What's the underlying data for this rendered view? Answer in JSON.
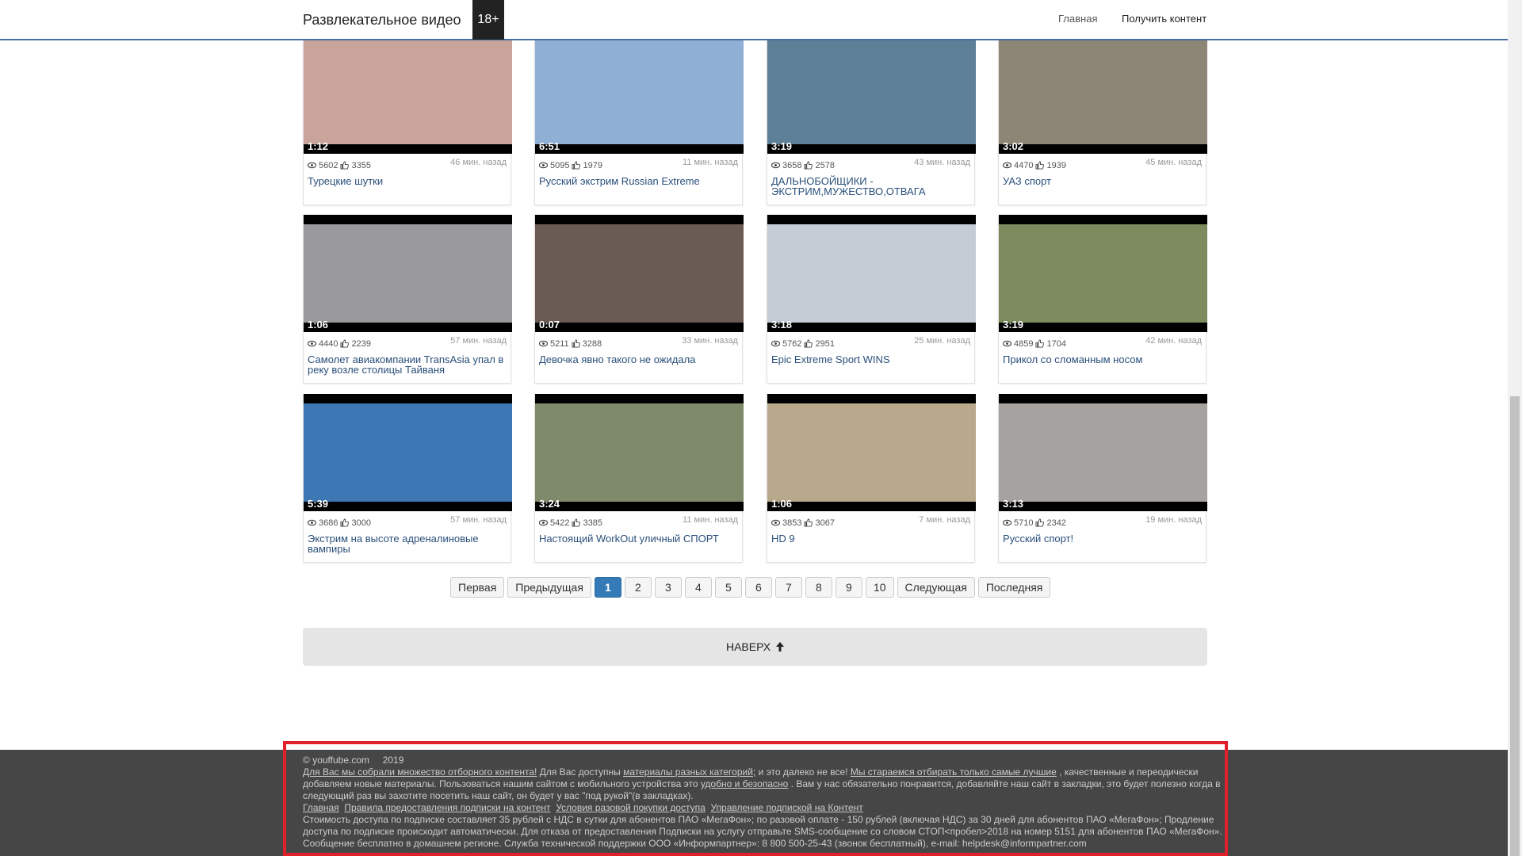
{
  "header": {
    "brand": "Развлекательное видео",
    "badge": "18+",
    "nav": [
      "Главная",
      "Получить контент"
    ]
  },
  "videos": [
    {
      "duration": "1:12",
      "views": "5602",
      "likes": "3355",
      "ago": "46 мин. назад",
      "title": "Турецкие шутки",
      "thumb": "#c9a49a"
    },
    {
      "duration": "6:51",
      "views": "5095",
      "likes": "1979",
      "ago": "11 мин. назад",
      "title": "Русский экстрим Russian Extreme",
      "thumb": "#8fb0d4"
    },
    {
      "duration": "3:19",
      "views": "3658",
      "likes": "2578",
      "ago": "43 мин. назад",
      "title": "ДАЛЬНОБОЙЩИКИ - ЭКСТРИМ,МУЖЕСТВО,ОТВАГА",
      "thumb": "#5d7f98"
    },
    {
      "duration": "3:02",
      "views": "4470",
      "likes": "1939",
      "ago": "45 мин. назад",
      "title": "УАЗ спорт",
      "thumb": "#8d8575"
    },
    {
      "duration": "1:06",
      "views": "4440",
      "likes": "2239",
      "ago": "57 мин. назад",
      "title": "Самолет авиакомпании TransAsia упал в реку возле столицы Тайваня",
      "thumb": "#9a9a9c"
    },
    {
      "duration": "0:07",
      "views": "5211",
      "likes": "3288",
      "ago": "33 мин. назад",
      "title": "Девочка явно такого не ожидала",
      "thumb": "#6b5b55"
    },
    {
      "duration": "3:18",
      "views": "5762",
      "likes": "2951",
      "ago": "25 мин. назад",
      "title": "Epic Extreme Sport WINS",
      "thumb": "#c5ccd6"
    },
    {
      "duration": "3:19",
      "views": "4859",
      "likes": "1704",
      "ago": "42 мин. назад",
      "title": "Прикол со сломанным носом",
      "thumb": "#7d8a5e"
    },
    {
      "duration": "5:39",
      "views": "3686",
      "likes": "3000",
      "ago": "57 мин. назад",
      "title": "Экстрим на высоте адреналиновые вампиры",
      "thumb": "#3d78b5"
    },
    {
      "duration": "3:24",
      "views": "5422",
      "likes": "3385",
      "ago": "11 мин. назад",
      "title": "Настоящий WorkOut уличный СПОРТ",
      "thumb": "#7f8a6a"
    },
    {
      "duration": "1:06",
      "views": "3853",
      "likes": "3067",
      "ago": "7 мин. назад",
      "title": "HD 9",
      "thumb": "#b9a98c"
    },
    {
      "duration": "3:13",
      "views": "5710",
      "likes": "2342",
      "ago": "19 мин. назад",
      "title": "Русский спорт!",
      "thumb": "#a6a2a0"
    }
  ],
  "pagination": {
    "first": "Первая",
    "prev": "Предыдущая",
    "pages": [
      "1",
      "2",
      "3",
      "4",
      "5",
      "6",
      "7",
      "8",
      "9",
      "10"
    ],
    "active": "1",
    "next": "Следующая",
    "last": "Последняя"
  },
  "to_top": "НАВЕРХ",
  "footer": {
    "site": "youffube.com",
    "year": "2019",
    "p1_link1": "Для Вас мы собрали множество отборного контента!",
    "p1_t1": " Для Вас доступны ",
    "p1_link2": "материалы разных категорий;",
    "p1_t2": " и это далеко не все! ",
    "p1_link3": "Мы стараемся отбирать только самые лучшие",
    "p1_t3": " , качественные и переодически добавляем новые материалы. Пользоваться нашим сайтом с мобильного устройства это ",
    "p1_link4": "удобно и безопасно",
    "p1_t4": " . Вам у нас обязательно понравится, добавляйте наш сайт в закладки, это будет полезно когда в следующий раз вы захотите посетить наш сайт, он будет у вас \"под рукой\"(в закладках).",
    "links": [
      "Главная",
      "Правила предоставления подписки на контент",
      "Условия разовой покупки доступа",
      "Управление подпиской на Контент"
    ],
    "legal": "Стоимость доступа по подписке составляет 35 рублей с НДС в сутки для абонентов ПАО «МегаФон»; по разовой оплате - 150 рублей (включая НДС) за 30 дней для абонентов ПАО «МегаФон»; Продление доступа по подписке происходит автоматически. Для отказа от предоставления Подписки на услугу отправьте SMS-сообщение со словом СТОП<пробел>2018 на номер 5151 для абонентов ПАО «МегаФон». Сообщение бесплатно в домашнем регионе. Служба технической поддержки ООО «Информпартнер»: 8 800 500-25-43 (звонок бесплатный), e-mail: helpdesk@informpartner.com"
  }
}
